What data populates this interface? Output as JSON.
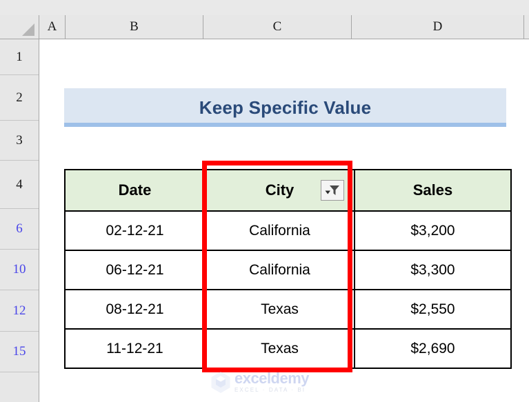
{
  "app": {
    "type": "spreadsheet"
  },
  "grid": {
    "column_headers": [
      "A",
      "B",
      "C",
      "D"
    ],
    "row_headers": [
      {
        "label": "1",
        "filtered": false
      },
      {
        "label": "2",
        "filtered": false
      },
      {
        "label": "3",
        "filtered": false
      },
      {
        "label": "4",
        "filtered": false
      },
      {
        "label": "6",
        "filtered": true
      },
      {
        "label": "10",
        "filtered": true
      },
      {
        "label": "12",
        "filtered": true
      },
      {
        "label": "15",
        "filtered": true
      }
    ]
  },
  "title": {
    "text": "Keep Specific Value",
    "background_color": "#dce6f2",
    "text_color": "#2a4a79",
    "underline_color": "#9ec0e8"
  },
  "table": {
    "header_background": "#e2efda",
    "columns": [
      "Date",
      "City",
      "Sales"
    ],
    "filter_column": "City",
    "filter_icon": "filter-funnel-dropdown-icon",
    "rows": [
      {
        "date": "02-12-21",
        "city": "California",
        "sales": "$3,200"
      },
      {
        "date": "06-12-21",
        "city": "California",
        "sales": "$3,300"
      },
      {
        "date": "08-12-21",
        "city": "Texas",
        "sales": "$2,550"
      },
      {
        "date": "11-12-21",
        "city": "Texas",
        "sales": "$2,690"
      }
    ]
  },
  "annotation": {
    "type": "red-rectangle-highlight",
    "target_column": "City",
    "color": "#ff0000"
  },
  "watermark": {
    "name": "exceldemy",
    "tagline": "EXCEL · DATA · BI",
    "name_color": "#8d9fe0",
    "tagline_color": "#a7b1cc"
  }
}
